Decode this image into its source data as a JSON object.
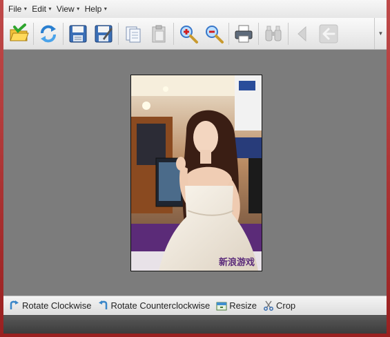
{
  "menubar": {
    "items": [
      {
        "label": "File"
      },
      {
        "label": "Edit"
      },
      {
        "label": "View"
      },
      {
        "label": "Help"
      }
    ]
  },
  "toolbar": {
    "buttons": [
      {
        "icon": "open-folder-icon",
        "enabled": true
      },
      {
        "icon": "refresh-icon",
        "enabled": true
      },
      {
        "icon": "save-icon",
        "enabled": true
      },
      {
        "icon": "save-as-icon",
        "enabled": true
      },
      {
        "icon": "copy-icon",
        "enabled": false
      },
      {
        "icon": "paste-icon",
        "enabled": false
      },
      {
        "icon": "zoom-in-icon",
        "enabled": true
      },
      {
        "icon": "zoom-out-icon",
        "enabled": true
      },
      {
        "icon": "print-icon",
        "enabled": true
      },
      {
        "icon": "binoculars-icon",
        "enabled": false
      },
      {
        "icon": "previous-icon",
        "enabled": false
      },
      {
        "icon": "back-arrow-icon",
        "enabled": false
      }
    ]
  },
  "photo": {
    "watermark": "新浪游戏"
  },
  "bottombar": {
    "rotate_cw_label": "Rotate Clockwise",
    "rotate_ccw_label": "Rotate Counterclockwise",
    "resize_label": "Resize",
    "crop_label": "Crop"
  },
  "colors": {
    "window_frame": "#b03030",
    "viewer_bg": "#7c7c7c",
    "statusbar": "#444444",
    "watermark": "#5a2a7a"
  }
}
